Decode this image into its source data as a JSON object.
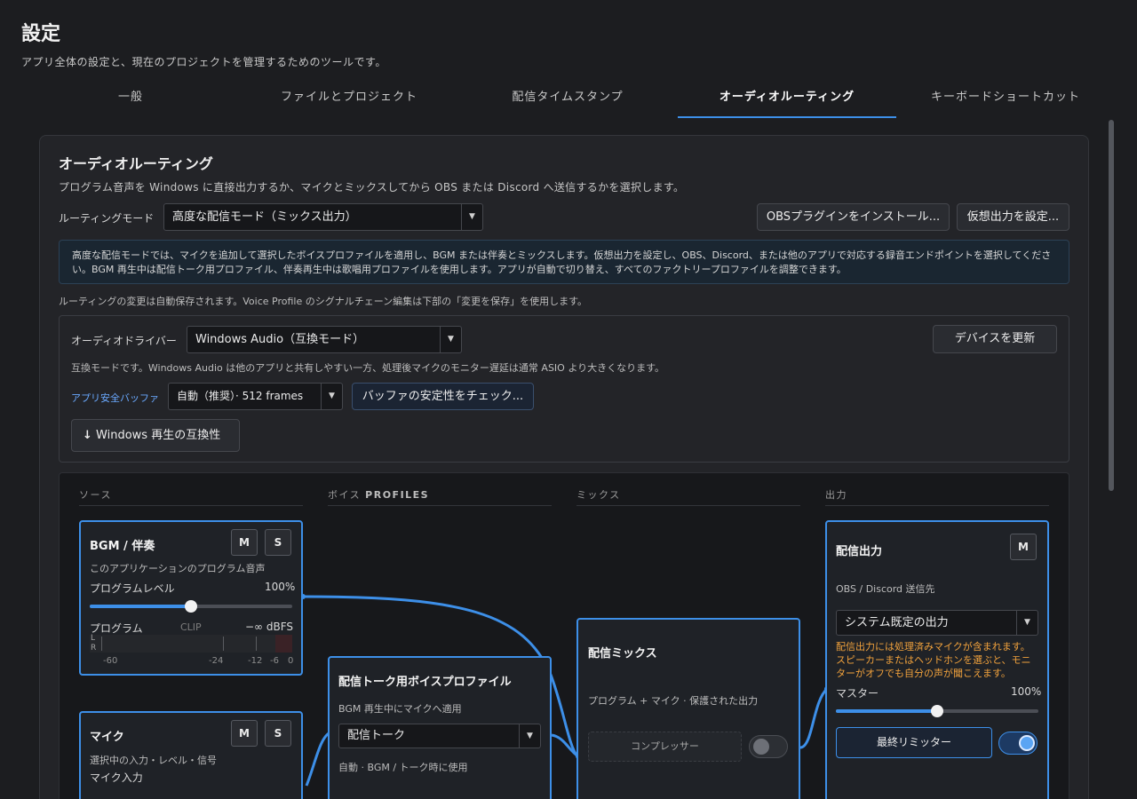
{
  "page": {
    "title": "設定",
    "subtitle": "アプリ全体の設定と、現在のプロジェクトを管理するためのツールです。"
  },
  "tabs": [
    "一般",
    "ファイルとプロジェクト",
    "配信タイムスタンプ",
    "オーディオルーティング",
    "キーボードショートカット"
  ],
  "active_tab": "オーディオルーティング",
  "routing": {
    "heading": "オーディオルーティング",
    "description": "プログラム音声を Windows に直接出力するか、マイクとミックスしてから OBS または Discord へ送信するかを選択します。",
    "mode_label": "ルーティングモード",
    "mode_value": "高度な配信モード（ミックス出力）",
    "install_obs_button": "OBSプラグインをインストール...",
    "virtual_output_button": "仮想出力を設定...",
    "info_text": "高度な配信モードでは、マイクを追加して選択したボイスプロファイルを適用し、BGM または伴奏とミックスします。仮想出力を設定し、OBS、Discord、または他のアプリで対応する録音エンドポイントを選択してください。BGM 再生中は配信トーク用プロファイル、伴奏再生中は歌唱用プロファイルを使用します。アプリが自動で切り替え、すべてのファクトリープロファイルを調整できます。",
    "autosave_note": "ルーティングの変更は自動保存されます。Voice Profile のシグナルチェーン編集は下部の「変更を保存」を使用します。"
  },
  "driver": {
    "label": "オーディオドライバー",
    "value": "Windows Audio（互換モード）",
    "refresh_button": "デバイスを更新",
    "hint": "互換モードです。Windows Audio は他のアプリと共有しやすい一方、処理後マイクのモニター遅延は通常 ASIO より大きくなります。",
    "buffer_label": "アプリ安全バッファ",
    "buffer_value": "自動（推奨）· 512 frames",
    "buffer_check_button": "バッファの安定性をチェック...",
    "compat_button": "Windows 再生の互換性",
    "compat_icon": "arrow-down-icon"
  },
  "graph": {
    "columns": [
      {
        "pre": "ソース",
        "bold": ""
      },
      {
        "pre": "ボイス ",
        "bold": "PROFILES"
      },
      {
        "pre": "ミックス",
        "bold": ""
      },
      {
        "pre": "出力",
        "bold": ""
      }
    ],
    "bgm_node": {
      "title": "BGM / 伴奏",
      "subtitle": "このアプリケーションのプログラム音声",
      "level_label": "プログラムレベル",
      "level_value": "100%",
      "level_fraction": 0.5,
      "meter_label": "プログラム",
      "clip_label": "CLIP",
      "db_value": "−∞ dBFS",
      "channels": [
        "L",
        "R"
      ],
      "scale": [
        "-60",
        "-24",
        "-12",
        "-6",
        "0"
      ],
      "mute": "M",
      "solo": "S"
    },
    "mic_node": {
      "title": "マイク",
      "subtitle": "選択中の入力・レベル・信号",
      "input_label": "マイク入力",
      "mute": "M",
      "solo": "S"
    },
    "profile_node": {
      "title": "配信トーク用ボイスプロファイル",
      "subtitle": "BGM 再生中にマイクへ適用",
      "profile_value": "配信トーク",
      "auto_note": "自動 · BGM / トーク時に使用"
    },
    "mix_node": {
      "title": "配信ミックス",
      "subtitle": "プログラム + マイク · 保護された出力",
      "compressor_label": "コンプレッサー",
      "compressor_on": false
    },
    "output_node": {
      "title": "配信出力",
      "subtitle": "OBS / Discord 送信先",
      "device_value": "システム既定の出力",
      "warning": "配信出力には処理済みマイクが含まれます。スピーカーまたはヘッドホンを選ぶと、モニターがオフでも自分の声が聞こえます。",
      "master_label": "マスター",
      "master_value": "100%",
      "master_fraction": 0.5,
      "limiter_button": "最終リミッター",
      "limiter_on": true,
      "mute": "M"
    }
  },
  "colors": {
    "accent": "#3d8fe8",
    "warning": "#f0a13c",
    "background": "#1c1d20"
  }
}
